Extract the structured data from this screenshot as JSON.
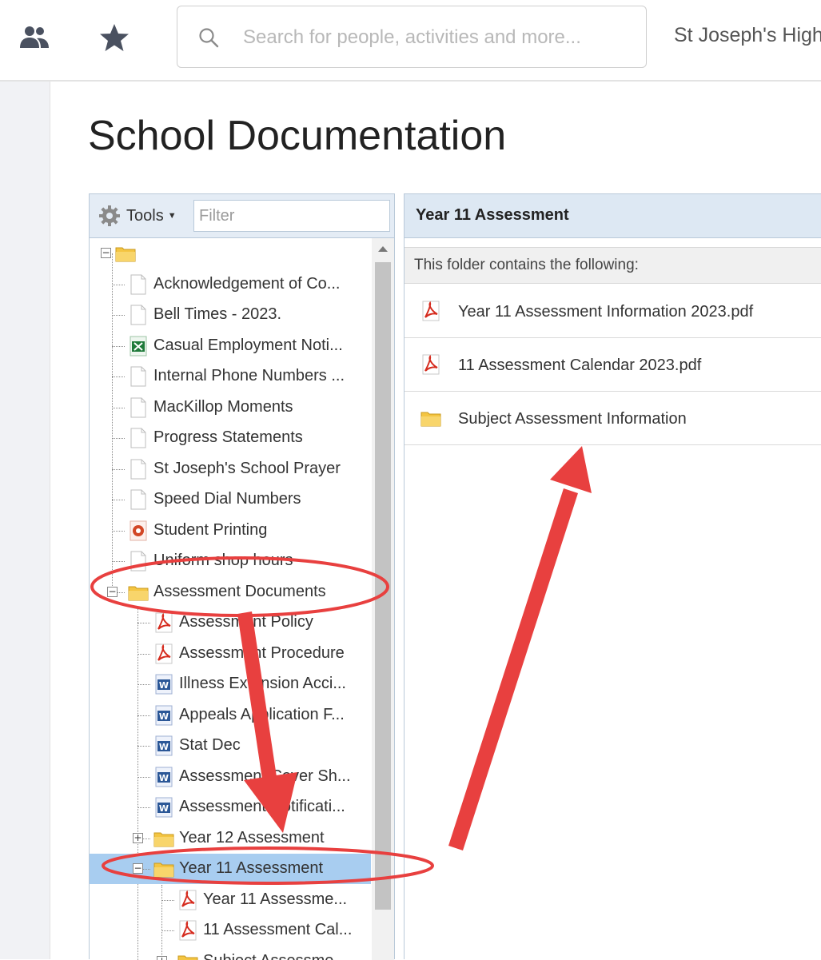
{
  "header": {
    "people_icon": "people-icon",
    "star_icon": "star-icon",
    "search_placeholder": "Search for people, activities and more...",
    "school_name": "St Joseph's High"
  },
  "page": {
    "title": "School Documentation"
  },
  "tree": {
    "tools_label": "Tools",
    "filter_placeholder": "Filter",
    "items": [
      {
        "label": "",
        "icon": "folder-icon",
        "level": 0,
        "expander": "minus"
      },
      {
        "label": "Acknowledgement of Co...",
        "icon": "document-icon",
        "level": 1
      },
      {
        "label": "Bell Times - 2023.",
        "icon": "document-icon",
        "level": 1
      },
      {
        "label": "Casual Employment Noti...",
        "icon": "excel-icon",
        "level": 1
      },
      {
        "label": "Internal Phone Numbers ...",
        "icon": "document-icon",
        "level": 1
      },
      {
        "label": "MacKillop Moments",
        "icon": "document-icon",
        "level": 1
      },
      {
        "label": "Progress Statements",
        "icon": "document-icon",
        "level": 1
      },
      {
        "label": "St Joseph's School Prayer",
        "icon": "document-icon",
        "level": 1
      },
      {
        "label": "Speed Dial Numbers",
        "icon": "document-icon",
        "level": 1
      },
      {
        "label": "Student Printing",
        "icon": "powerpoint-icon",
        "level": 1
      },
      {
        "label": "Uniform shop hours",
        "icon": "document-icon",
        "level": 1
      },
      {
        "label": "Assessment Documents",
        "icon": "folder-icon",
        "level": 1,
        "expander": "minus"
      },
      {
        "label": "Assessment Policy",
        "icon": "pdf-icon",
        "level": 2
      },
      {
        "label": "Assessment Procedure",
        "icon": "pdf-icon",
        "level": 2
      },
      {
        "label": "Illness Extension Acci...",
        "icon": "word-icon",
        "level": 2
      },
      {
        "label": "Appeals Application F...",
        "icon": "word-icon",
        "level": 2
      },
      {
        "label": "Stat Dec",
        "icon": "word-icon",
        "level": 2
      },
      {
        "label": "Assessment Cover Sh...",
        "icon": "word-icon",
        "level": 2
      },
      {
        "label": "Assessment Notificati...",
        "icon": "word-icon",
        "level": 2
      },
      {
        "label": "Year 12 Assessment",
        "icon": "folder-icon",
        "level": 2,
        "expander": "plus"
      },
      {
        "label": "Year 11 Assessment",
        "icon": "folder-icon",
        "level": 2,
        "expander": "minus",
        "selected": true
      },
      {
        "label": "Year 11 Assessme...",
        "icon": "pdf-icon",
        "level": 3
      },
      {
        "label": "11 Assessment Cal...",
        "icon": "pdf-icon",
        "level": 3
      },
      {
        "label": "Subject Assessme...",
        "icon": "folder-icon",
        "level": 3,
        "expander": "plus"
      }
    ]
  },
  "content": {
    "title": "Year 11 Assessment",
    "subheader": "This folder contains the following:",
    "items": [
      {
        "label": "Year 11 Assessment Information 2023.pdf",
        "icon": "pdf-icon"
      },
      {
        "label": "11 Assessment Calendar 2023.pdf",
        "icon": "pdf-icon"
      },
      {
        "label": "Subject Assessment Information",
        "icon": "folder-icon"
      }
    ]
  },
  "colors": {
    "selected_row": "#a8cdf0",
    "panel_header": "#dde8f3",
    "annotation_red": "#e8403f",
    "folder_yellow": "#f4c542",
    "pdf_red": "#d52b1e",
    "word_blue": "#2b5797",
    "excel_green": "#1f7a3a"
  }
}
